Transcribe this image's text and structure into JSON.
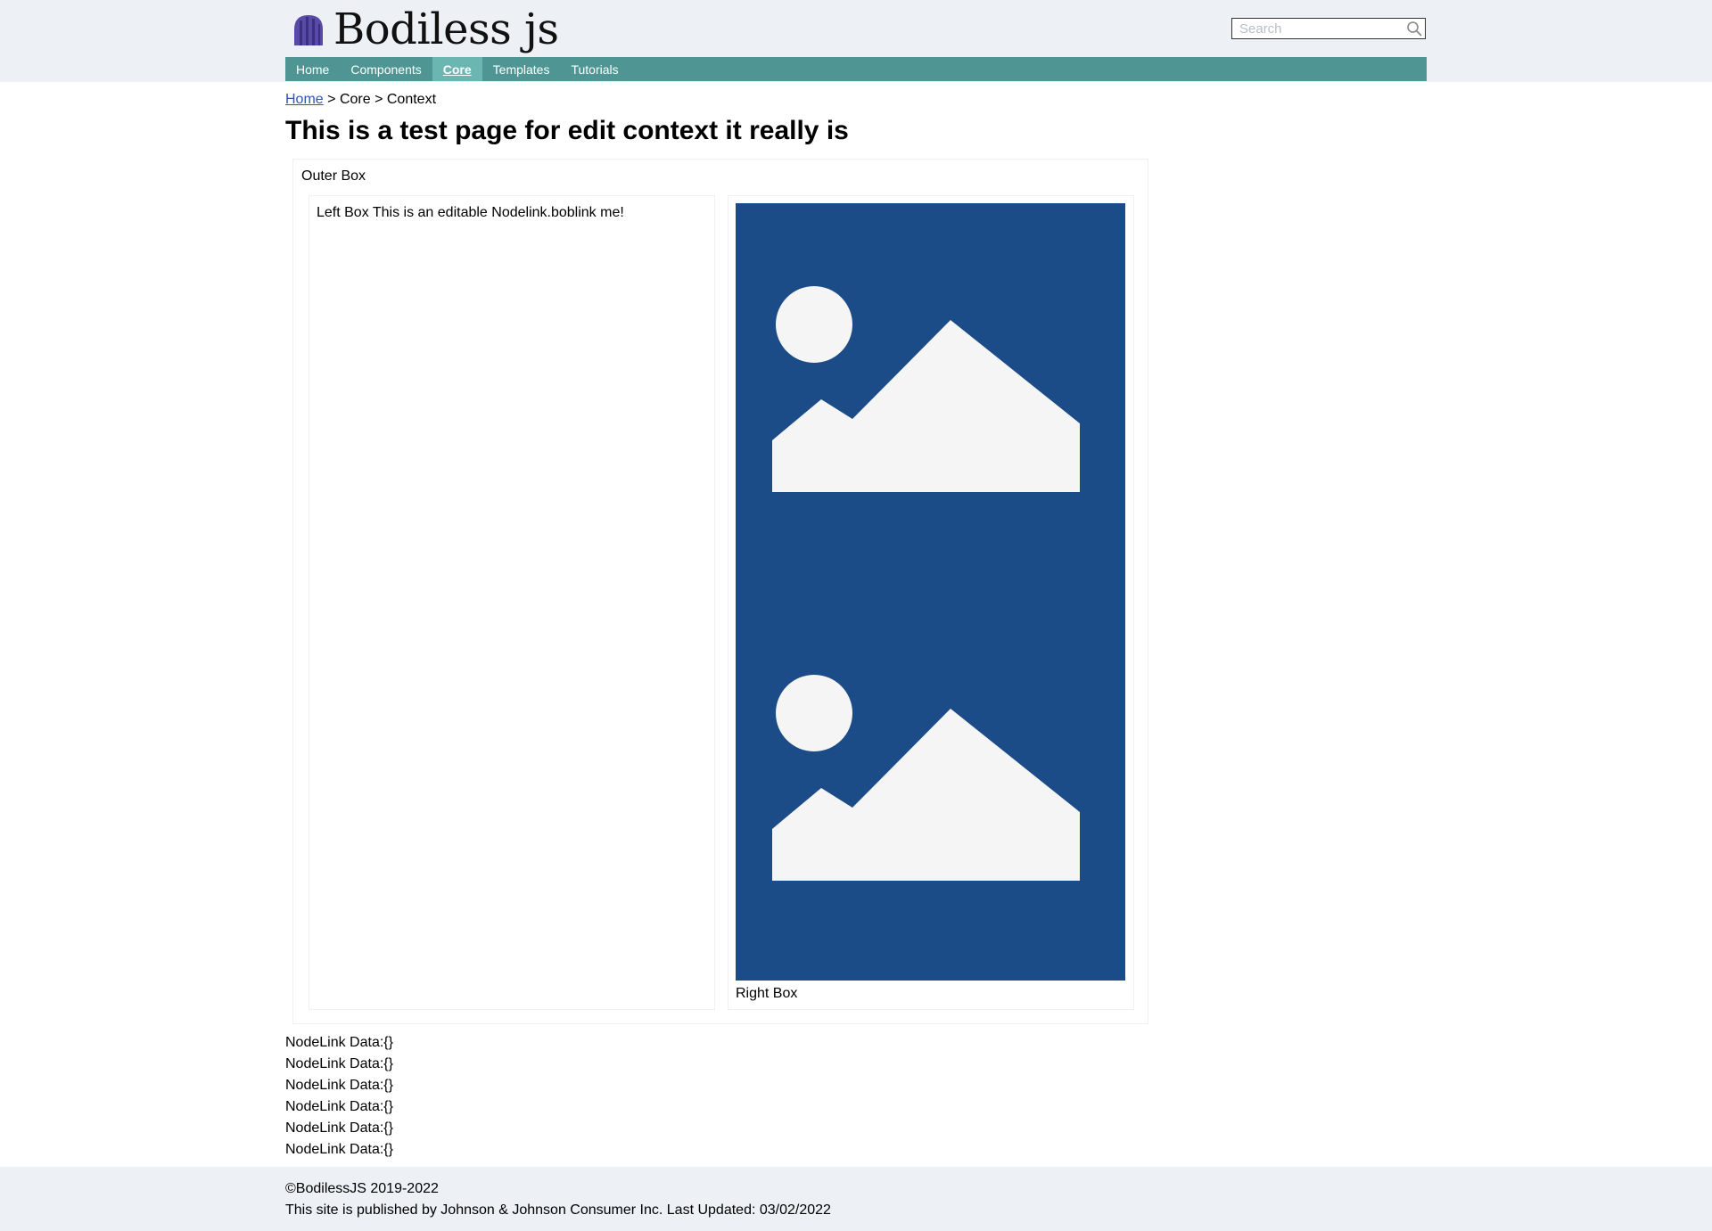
{
  "site": {
    "logo_text": "Bodiless js"
  },
  "search": {
    "placeholder": "Search"
  },
  "nav": {
    "items": [
      {
        "label": "Home"
      },
      {
        "label": "Components"
      },
      {
        "label": "Core"
      },
      {
        "label": "Templates"
      },
      {
        "label": "Tutorials"
      }
    ],
    "active": "Core"
  },
  "breadcrumb": {
    "home": "Home",
    "sep1": ">",
    "core": "Core",
    "sep2": ">",
    "current": "Context"
  },
  "page": {
    "title": "This is a test page for edit context it really is"
  },
  "outer_box": {
    "label": "Outer Box"
  },
  "left_box": {
    "text": "Left Box This is an editable Nodelink.boblink me!"
  },
  "right_box": {
    "label": "Right Box",
    "image_background": "#1b4c87"
  },
  "nodelink_data": [
    "NodeLink Data:{}",
    "NodeLink Data:{}",
    "NodeLink Data:{}",
    "NodeLink Data:{}",
    "NodeLink Data:{}",
    "NodeLink Data:{}"
  ],
  "footer": {
    "copyright": "©BodilessJS 2019-2022",
    "published": "This site is published by Johnson & Johnson Consumer Inc. Last Updated: 03/02/2022"
  },
  "colors": {
    "nav_background": "#4e9594",
    "nav_active": "#6cb6b1",
    "header_background": "#edf0f5",
    "link": "#2f55b7"
  }
}
